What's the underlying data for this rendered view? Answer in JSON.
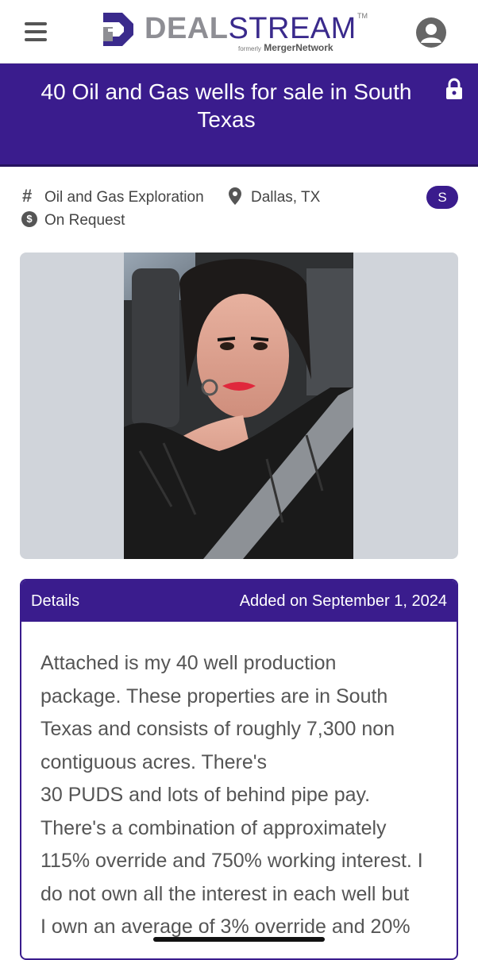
{
  "header": {
    "logo": {
      "brand_deal": "DEAL",
      "brand_stream": "STREAM",
      "trademark": "TM",
      "formerly_prefix": "formerly",
      "formerly_name": "MergerNetwork"
    },
    "menu_icon": "hamburger-menu-icon",
    "user_icon": "user-account-icon"
  },
  "listing": {
    "title": "40 Oil and Gas wells for sale in South Texas",
    "lock_icon": "lock-icon",
    "category": "Oil and Gas Exploration",
    "location": "Dallas, TX",
    "price": "On Request",
    "seller_badge": "S",
    "photo_icon": "listing-photo"
  },
  "details": {
    "label": "Details",
    "added": "Added on September 1, 2024",
    "lines": [
      "Attached is my 40 well production",
      "package. These properties are in South",
      "Texas and consists of roughly 7,300 non",
      "contiguous acres. There's",
      "30 PUDS and lots of behind pipe pay.",
      "There's a combination of approximately",
      "115% override and 750% working interest. I",
      "do not own all the interest in each well but",
      "I own an average of 3% override and 20%"
    ]
  },
  "colors": {
    "brand_purple": "#3a1c8d",
    "logo_gray": "#8e8e94",
    "photo_bg": "#d0d4da"
  }
}
